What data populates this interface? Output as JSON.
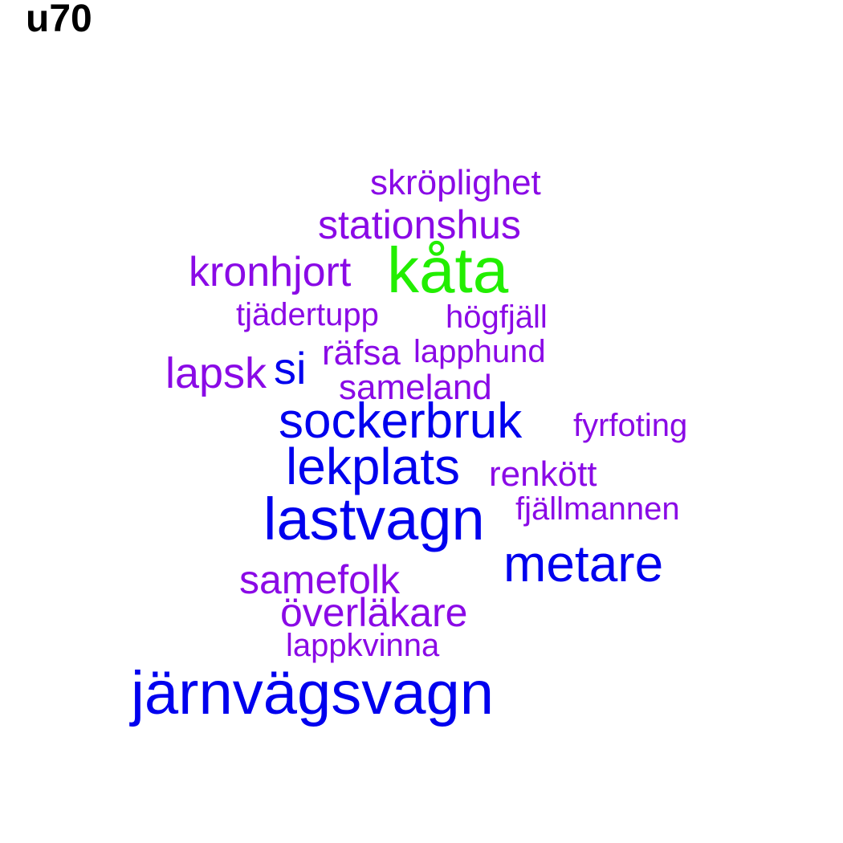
{
  "title": "u70",
  "colors": {
    "green": "#22ee00",
    "blue": "#0000ee",
    "purple": "#8a0ae6"
  },
  "words": [
    {
      "text": "skröplighet",
      "color": "purple"
    },
    {
      "text": "stationshus",
      "color": "purple"
    },
    {
      "text": "kronhjort",
      "color": "purple"
    },
    {
      "text": "kåta",
      "color": "green"
    },
    {
      "text": "tjädertupp",
      "color": "purple"
    },
    {
      "text": "högfjäll",
      "color": "purple"
    },
    {
      "text": "räfsa",
      "color": "purple"
    },
    {
      "text": "lapphund",
      "color": "purple"
    },
    {
      "text": "lapsk",
      "color": "purple"
    },
    {
      "text": "si",
      "color": "blue"
    },
    {
      "text": "sameland",
      "color": "purple"
    },
    {
      "text": "sockerbruk",
      "color": "blue"
    },
    {
      "text": "fyrfoting",
      "color": "purple"
    },
    {
      "text": "lekplats",
      "color": "blue"
    },
    {
      "text": "renkött",
      "color": "purple"
    },
    {
      "text": "fjällmannen",
      "color": "purple"
    },
    {
      "text": "lastvagn",
      "color": "blue"
    },
    {
      "text": "metare",
      "color": "blue"
    },
    {
      "text": "samefolk",
      "color": "purple"
    },
    {
      "text": "överläkare",
      "color": "purple"
    },
    {
      "text": "lappkvinna",
      "color": "purple"
    },
    {
      "text": "järnvägsvagn",
      "color": "blue"
    }
  ]
}
